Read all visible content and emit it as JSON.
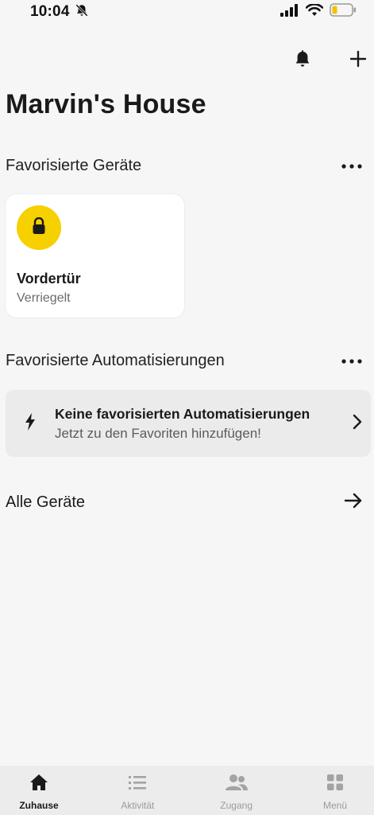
{
  "status_bar": {
    "time": "10:04",
    "icons": [
      "bell-slash-icon",
      "signal-icon",
      "wifi-icon",
      "battery-low-icon"
    ],
    "battery_color": "#f2c200"
  },
  "header": {
    "title": "Marvin's House",
    "actions": [
      "bell-icon",
      "plus-icon"
    ]
  },
  "favorite_devices": {
    "title": "Favorisierte Geräte",
    "devices": [
      {
        "name": "Vordertür",
        "status": "Verriegelt",
        "icon": "lock-icon",
        "accent": "#f7d000"
      }
    ]
  },
  "favorite_automations": {
    "title": "Favorisierte Automatisierungen",
    "empty_title": "Keine favorisierten Automatisierungen",
    "empty_subtitle": "Jetzt zu den Favoriten hinzufügen!",
    "icon": "bolt-icon"
  },
  "all_devices": {
    "label": "Alle Geräte"
  },
  "tabs": [
    {
      "label": "Zuhause",
      "icon": "home-icon",
      "active": true
    },
    {
      "label": "Aktivität",
      "icon": "list-icon",
      "active": false
    },
    {
      "label": "Zugang",
      "icon": "users-icon",
      "active": false
    },
    {
      "label": "Menü",
      "icon": "grid-icon",
      "active": false
    }
  ]
}
